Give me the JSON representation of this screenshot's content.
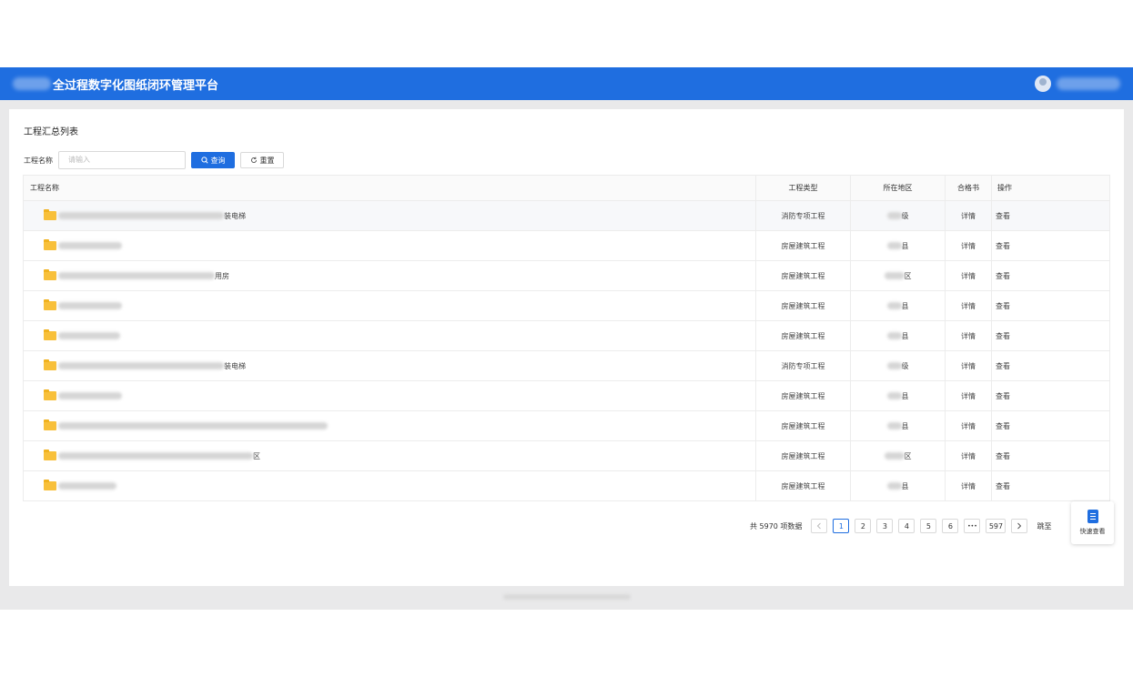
{
  "header": {
    "title": "全过程数字化图纸闭环管理平台"
  },
  "page": {
    "title": "工程汇总列表",
    "search": {
      "label": "工程名称",
      "placeholder": "请输入",
      "query_button": "查询",
      "reset_button": "重置"
    }
  },
  "table": {
    "columns": [
      "工程名称",
      "工程类型",
      "所在地区",
      "合格书",
      "操作"
    ],
    "rows": [
      {
        "name_tail": "装电梯",
        "type": "消防专项工程",
        "region_tail": "级",
        "cert": "详情",
        "action": "查看"
      },
      {
        "name_tail": "",
        "type": "房屋建筑工程",
        "region_tail": "县",
        "cert": "详情",
        "action": "查看"
      },
      {
        "name_tail": "用房",
        "type": "房屋建筑工程",
        "region_tail": "区",
        "cert": "详情",
        "action": "查看"
      },
      {
        "name_tail": "",
        "type": "房屋建筑工程",
        "region_tail": "县",
        "cert": "详情",
        "action": "查看"
      },
      {
        "name_tail": "",
        "type": "房屋建筑工程",
        "region_tail": "县",
        "cert": "详情",
        "action": "查看"
      },
      {
        "name_tail": "装电梯",
        "type": "消防专项工程",
        "region_tail": "级",
        "cert": "详情",
        "action": "查看"
      },
      {
        "name_tail": "",
        "type": "房屋建筑工程",
        "region_tail": "县",
        "cert": "详情",
        "action": "查看"
      },
      {
        "name_tail": "",
        "type": "房屋建筑工程",
        "region_tail": "县",
        "cert": "详情",
        "action": "查看"
      },
      {
        "name_tail": "区",
        "type": "房屋建筑工程",
        "region_tail": "区",
        "cert": "详情",
        "action": "查看"
      },
      {
        "name_tail": "",
        "type": "房屋建筑工程",
        "region_tail": "县",
        "cert": "详情",
        "action": "查看"
      }
    ]
  },
  "pagination": {
    "total_text": "共 5970 项数据",
    "pages": [
      "1",
      "2",
      "3",
      "4",
      "5",
      "6"
    ],
    "ellipsis": "•••",
    "last_page": "597",
    "jump_label": "跳至",
    "prev_icon": "chevron-left-icon",
    "next_icon": "chevron-right-icon"
  },
  "quick_view": {
    "label": "快速查看",
    "icon": "document-icon"
  },
  "colors": {
    "primary": "#1f6ee0",
    "folder": "#f8c03a"
  }
}
